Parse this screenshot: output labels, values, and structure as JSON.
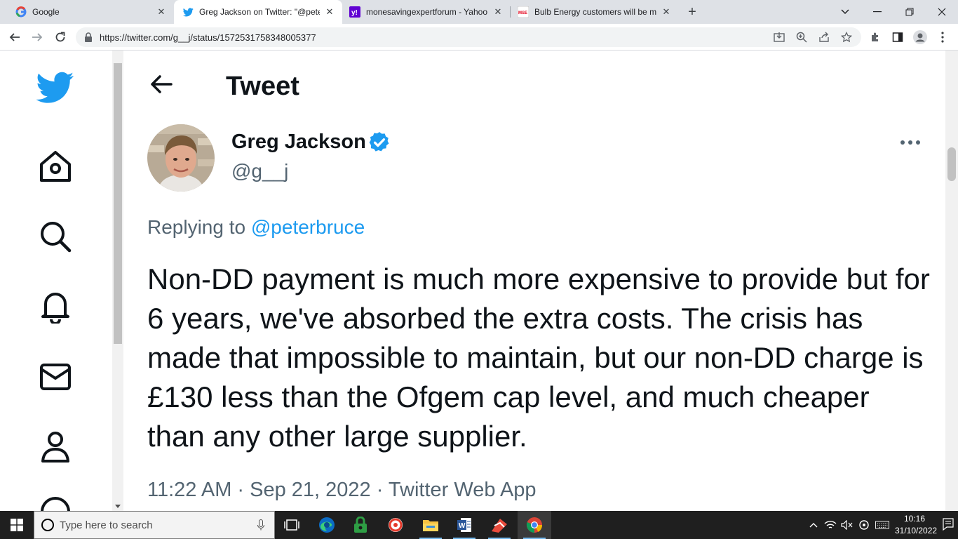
{
  "browser": {
    "tabs": [
      {
        "title": "Google",
        "favicon": "google-icon",
        "active": false
      },
      {
        "title": "Greg Jackson on Twitter: \"@peter",
        "favicon": "twitter-icon",
        "active": true
      },
      {
        "title": "monesavingexpertforum - Yahoo",
        "favicon": "yahoo-icon",
        "active": false
      },
      {
        "title": "Bulb Energy customers will be m",
        "favicon": "mse-icon",
        "active": false
      }
    ],
    "url": "https://twitter.com/g__j/status/1572531758348005377"
  },
  "sidebar": {
    "items": [
      {
        "name": "twitter-logo-icon"
      },
      {
        "name": "home-icon"
      },
      {
        "name": "explore-icon"
      },
      {
        "name": "notifications-icon"
      },
      {
        "name": "messages-icon"
      },
      {
        "name": "profile-icon"
      }
    ]
  },
  "header": {
    "title": "Tweet"
  },
  "tweet": {
    "author_name": "Greg Jackson",
    "handle": "@g__j",
    "replying_prefix": "Replying to ",
    "replying_to": "@peterbruce",
    "text": "Non-DD payment is much more expensive to provide but for 6 years, we've absorbed the extra costs. The crisis has made that impossible to maintain, but our non-DD charge is £130 less than the Ofgem cap level, and much cheaper than any other large supplier.",
    "meta": "11:22 AM · Sep 21, 2022 · Twitter Web App"
  },
  "taskbar": {
    "search_placeholder": "Type here to search",
    "time": "10:16",
    "date": "31/10/2022"
  },
  "colors": {
    "twitter_blue": "#1d9bf0",
    "text_primary": "#0f1419",
    "text_secondary": "#536471",
    "tabstrip_bg": "#dee1e6",
    "taskbar_bg": "#1f1f1f"
  }
}
